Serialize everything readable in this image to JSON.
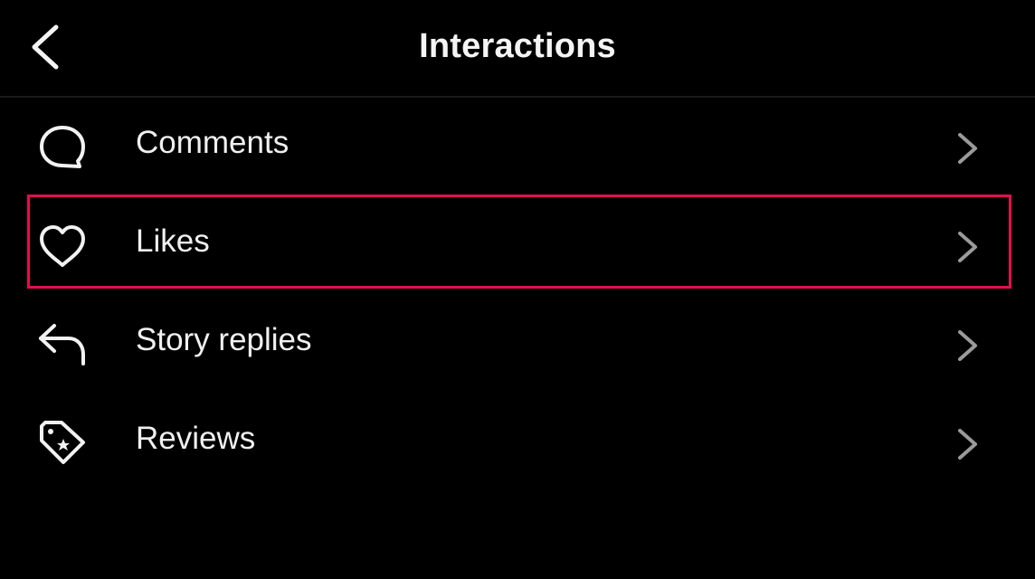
{
  "header": {
    "title": "Interactions",
    "back_icon": "chevron-left-icon"
  },
  "items": [
    {
      "label": "Comments",
      "icon": "comment-bubble-icon",
      "chevron": "chevron-right-icon"
    },
    {
      "label": "Likes",
      "icon": "heart-icon",
      "chevron": "chevron-right-icon",
      "highlighted": true
    },
    {
      "label": "Story replies",
      "icon": "reply-arrow-icon",
      "chevron": "chevron-right-icon"
    },
    {
      "label": "Reviews",
      "icon": "tag-star-icon",
      "chevron": "chevron-right-icon"
    }
  ],
  "colors": {
    "background": "#000000",
    "text": "#f2f2f2",
    "chevron": "#9a9a9a",
    "highlight": "#e0104f"
  }
}
